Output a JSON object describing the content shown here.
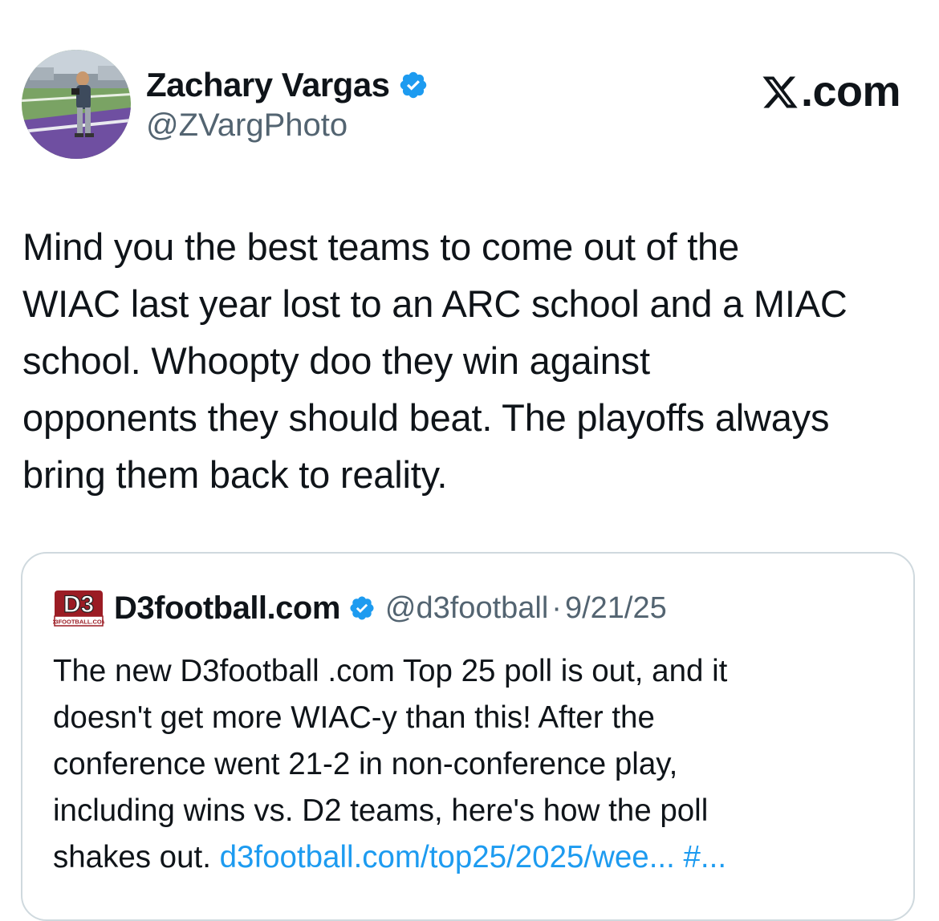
{
  "author": {
    "name": "Zachary Vargas",
    "handle": "@ZVargPhoto",
    "verified": true
  },
  "brand": {
    "label": ".com",
    "icon": "x-logo-icon"
  },
  "tweet": {
    "lines": [
      "Mind you the best teams to come out of the",
      "WIAC last year lost to an ARC school and a MIAC",
      "school. Whoopty doo they win against",
      "opponents they should beat. The playoffs always",
      "bring them back to reality."
    ]
  },
  "quoted_tweet": {
    "logo_text": "D3",
    "logo_subtext": "D3FOOTBALL.COM",
    "name": "D3football.com",
    "verified": true,
    "handle": "@d3football",
    "separator": "·",
    "date": "9/21/25",
    "lines": [
      "The new D3football .com Top 25 poll is out, and it",
      "doesn't get more WIAC-y than this! After the",
      "conference went 21-2 in non-conference play,",
      "including wins vs. D2 teams, here's how the poll",
      "shakes out."
    ],
    "link": "d3football.com/top25/2025/wee...",
    "hashtag": "#..."
  },
  "colors": {
    "verified_blue": "#1d9bf0",
    "text_primary": "#0f1419",
    "text_secondary": "#536471",
    "border": "#cfd9de",
    "logo_red": "#9b1c24"
  }
}
